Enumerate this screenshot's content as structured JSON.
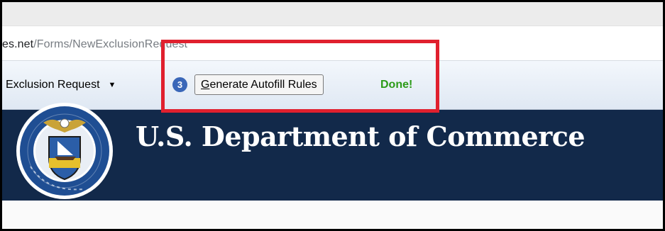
{
  "browser": {
    "url_domain": "es.net",
    "url_path": "/Forms/NewExclusionRequest"
  },
  "toolbar": {
    "request_type_selected": "Exclusion Request",
    "dropdown_arrow": "▼",
    "step_number": "3",
    "generate_button_label": "enerate Autofill Rules",
    "generate_button_mnemonic": "G",
    "status_text": "Done!"
  },
  "banner": {
    "title": "U.S. Department of Commerce",
    "seal_icon": "commerce-seal-icon",
    "background_color": "#12294a"
  },
  "annotation": {
    "highlight_color": "#e0202e"
  }
}
